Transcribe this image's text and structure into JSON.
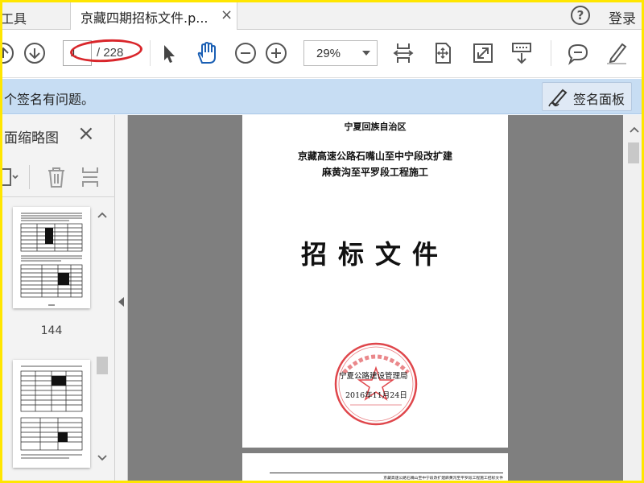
{
  "tabbar": {
    "tools_tab": "工具",
    "document_tab_title": "京藏四期招标文件.p...",
    "close_glyph": "×",
    "help_glyph": "?",
    "login_label": "登录"
  },
  "toolbar": {
    "current_page": "1",
    "total_pages": "/ 228",
    "zoom_value": "29%",
    "tools": [
      "previous-page",
      "next-page",
      "select",
      "hand",
      "zoom-out",
      "zoom-in",
      "fit-width",
      "fit-page",
      "full-screen",
      "scroll-mode",
      "comment",
      "sign"
    ]
  },
  "signature_bar": {
    "message": "个签名有问题。",
    "panel_button": "签名面板"
  },
  "thumbnails": {
    "title": "面缩略图",
    "close_glyph": "×",
    "items": [
      {
        "page_number": "144"
      },
      {
        "page_number": ""
      }
    ]
  },
  "document": {
    "page1": {
      "region": "宁夏回族自治区",
      "project_line1": "京藏高速公路石嘴山至中宁段改扩建",
      "project_line2": "麻黄沟至平罗段工程施工",
      "title": "招标文件",
      "seal_issuer": "宁夏公路建设管理局",
      "date": "2016年11月24日"
    },
    "page2": {
      "header": "京藏高速公路石嘴山至中宁段改扩建麻黄沟至平罗段工程施工招标文件"
    }
  },
  "colors": {
    "accent_blue": "#1a5fb4",
    "banner_bg": "#c7ddf3",
    "annotation_red": "#d9262b",
    "frame_yellow": "#ffe600",
    "doc_bg": "#7f7f7f"
  }
}
